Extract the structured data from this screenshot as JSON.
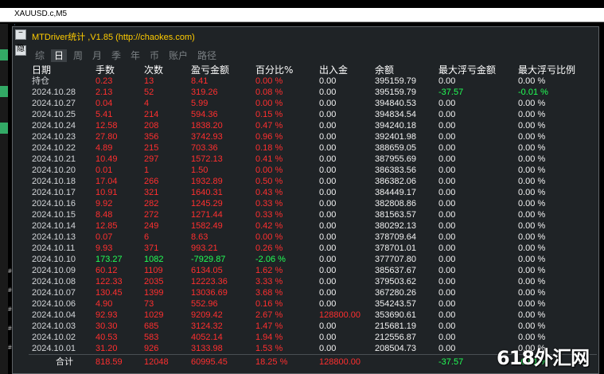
{
  "chart": {
    "symbol_tab": "XAUUSD.c,M5",
    "side_marks": [
      "#3",
      "#3",
      "#3",
      "#3",
      "#3"
    ]
  },
  "window": {
    "title": "MTDriver统计 ,V1.85 (http://chaokes.com)",
    "btn_top": "−",
    "btn_bottom": "隐"
  },
  "tabs": [
    {
      "label": "综",
      "active": false
    },
    {
      "label": "日",
      "active": true
    },
    {
      "label": "周",
      "active": false
    },
    {
      "label": "月",
      "active": false
    },
    {
      "label": "季",
      "active": false
    },
    {
      "label": "年",
      "active": false
    },
    {
      "label": "币",
      "active": false
    },
    {
      "label": "账户",
      "active": false
    },
    {
      "label": "路径",
      "active": false
    }
  ],
  "columns": [
    "日期",
    "手数",
    "次数",
    "盈亏金额",
    "百分比%",
    "出入金",
    "余额",
    "最大浮亏金额",
    "最大浮亏比例"
  ],
  "rows": [
    {
      "date": "持仓",
      "lots": "0.23",
      "count": "13",
      "pl": "8.41",
      "pct": "0.00 %",
      "flow": "0.00",
      "bal": "395159.79",
      "maxamt": "0.00",
      "maxpct": "0.00 %",
      "color": "red"
    },
    {
      "date": "2024.10.28",
      "lots": "2.13",
      "count": "52",
      "pl": "319.26",
      "pct": "0.08 %",
      "flow": "0.00",
      "bal": "395159.79",
      "maxamt": "-37.57",
      "maxpct": "-0.01 %",
      "color": "red",
      "maxcolor": "green"
    },
    {
      "date": "2024.10.27",
      "lots": "0.04",
      "count": "4",
      "pl": "5.99",
      "pct": "0.00 %",
      "flow": "0.00",
      "bal": "394840.53",
      "maxamt": "0.00",
      "maxpct": "0.00 %",
      "color": "red"
    },
    {
      "date": "2024.10.25",
      "lots": "5.41",
      "count": "214",
      "pl": "594.36",
      "pct": "0.15 %",
      "flow": "0.00",
      "bal": "394834.54",
      "maxamt": "0.00",
      "maxpct": "0.00 %",
      "color": "red"
    },
    {
      "date": "2024.10.24",
      "lots": "12.58",
      "count": "208",
      "pl": "1838.20",
      "pct": "0.47 %",
      "flow": "0.00",
      "bal": "394240.18",
      "maxamt": "0.00",
      "maxpct": "0.00 %",
      "color": "red"
    },
    {
      "date": "2024.10.23",
      "lots": "27.80",
      "count": "356",
      "pl": "3742.93",
      "pct": "0.96 %",
      "flow": "0.00",
      "bal": "392401.98",
      "maxamt": "0.00",
      "maxpct": "0.00 %",
      "color": "red"
    },
    {
      "date": "2024.10.22",
      "lots": "4.89",
      "count": "215",
      "pl": "703.36",
      "pct": "0.18 %",
      "flow": "0.00",
      "bal": "388659.05",
      "maxamt": "0.00",
      "maxpct": "0.00 %",
      "color": "red"
    },
    {
      "date": "2024.10.21",
      "lots": "10.49",
      "count": "297",
      "pl": "1572.13",
      "pct": "0.41 %",
      "flow": "0.00",
      "bal": "387955.69",
      "maxamt": "0.00",
      "maxpct": "0.00 %",
      "color": "red"
    },
    {
      "date": "2024.10.20",
      "lots": "0.01",
      "count": "1",
      "pl": "1.50",
      "pct": "0.00 %",
      "flow": "0.00",
      "bal": "386383.56",
      "maxamt": "0.00",
      "maxpct": "0.00 %",
      "color": "red"
    },
    {
      "date": "2024.10.18",
      "lots": "17.04",
      "count": "266",
      "pl": "1932.89",
      "pct": "0.50 %",
      "flow": "0.00",
      "bal": "386382.06",
      "maxamt": "0.00",
      "maxpct": "0.00 %",
      "color": "red"
    },
    {
      "date": "2024.10.17",
      "lots": "10.91",
      "count": "321",
      "pl": "1640.31",
      "pct": "0.43 %",
      "flow": "0.00",
      "bal": "384449.17",
      "maxamt": "0.00",
      "maxpct": "0.00 %",
      "color": "red"
    },
    {
      "date": "2024.10.16",
      "lots": "9.92",
      "count": "282",
      "pl": "1245.29",
      "pct": "0.33 %",
      "flow": "0.00",
      "bal": "382808.86",
      "maxamt": "0.00",
      "maxpct": "0.00 %",
      "color": "red"
    },
    {
      "date": "2024.10.15",
      "lots": "8.48",
      "count": "272",
      "pl": "1271.44",
      "pct": "0.33 %",
      "flow": "0.00",
      "bal": "381563.57",
      "maxamt": "0.00",
      "maxpct": "0.00 %",
      "color": "red"
    },
    {
      "date": "2024.10.14",
      "lots": "12.85",
      "count": "249",
      "pl": "1582.49",
      "pct": "0.42 %",
      "flow": "0.00",
      "bal": "380292.13",
      "maxamt": "0.00",
      "maxpct": "0.00 %",
      "color": "red"
    },
    {
      "date": "2024.10.13",
      "lots": "0.07",
      "count": "6",
      "pl": "8.63",
      "pct": "0.00 %",
      "flow": "0.00",
      "bal": "378709.64",
      "maxamt": "0.00",
      "maxpct": "0.00 %",
      "color": "red"
    },
    {
      "date": "2024.10.11",
      "lots": "9.93",
      "count": "371",
      "pl": "993.21",
      "pct": "0.26 %",
      "flow": "0.00",
      "bal": "378701.01",
      "maxamt": "0.00",
      "maxpct": "0.00 %",
      "color": "red"
    },
    {
      "date": "2024.10.10",
      "lots": "173.27",
      "count": "1082",
      "pl": "-7929.87",
      "pct": "-2.06 %",
      "flow": "0.00",
      "bal": "377707.80",
      "maxamt": "0.00",
      "maxpct": "0.00 %",
      "color": "green"
    },
    {
      "date": "2024.10.09",
      "lots": "60.12",
      "count": "1109",
      "pl": "6134.05",
      "pct": "1.62 %",
      "flow": "0.00",
      "bal": "385637.67",
      "maxamt": "0.00",
      "maxpct": "0.00 %",
      "color": "red"
    },
    {
      "date": "2024.10.08",
      "lots": "122.33",
      "count": "2035",
      "pl": "12223.36",
      "pct": "3.33 %",
      "flow": "0.00",
      "bal": "379503.62",
      "maxamt": "0.00",
      "maxpct": "0.00 %",
      "color": "red"
    },
    {
      "date": "2024.10.07",
      "lots": "130.45",
      "count": "1399",
      "pl": "13036.69",
      "pct": "3.68 %",
      "flow": "0.00",
      "bal": "367280.26",
      "maxamt": "0.00",
      "maxpct": "0.00 %",
      "color": "red"
    },
    {
      "date": "2024.10.06",
      "lots": "4.90",
      "count": "73",
      "pl": "552.96",
      "pct": "0.16 %",
      "flow": "0.00",
      "bal": "354243.57",
      "maxamt": "0.00",
      "maxpct": "0.00 %",
      "color": "red"
    },
    {
      "date": "2024.10.04",
      "lots": "92.93",
      "count": "1029",
      "pl": "9209.42",
      "pct": "2.67 %",
      "flow": "128800.00",
      "bal": "353690.61",
      "maxamt": "0.00",
      "maxpct": "0.00 %",
      "color": "red",
      "flowcolor": "red"
    },
    {
      "date": "2024.10.03",
      "lots": "30.30",
      "count": "685",
      "pl": "3124.32",
      "pct": "1.47 %",
      "flow": "0.00",
      "bal": "215681.19",
      "maxamt": "0.00",
      "maxpct": "0.00 %",
      "color": "red"
    },
    {
      "date": "2024.10.02",
      "lots": "40.53",
      "count": "583",
      "pl": "4052.14",
      "pct": "1.94 %",
      "flow": "0.00",
      "bal": "212556.87",
      "maxamt": "0.00",
      "maxpct": "0.00 %",
      "color": "red"
    },
    {
      "date": "2024.10.01",
      "lots": "31.20",
      "count": "926",
      "pl": "3133.98",
      "pct": "1.53 %",
      "flow": "0.00",
      "bal": "208504.73",
      "maxamt": "0.00",
      "maxpct": "0.00 %",
      "color": "red"
    }
  ],
  "total": {
    "label": "合计",
    "lots": "818.59",
    "count": "12048",
    "pl": "60995.45",
    "pct": "18.25 %",
    "flow": "128800.00",
    "maxamt": "-37.57",
    "maxpct": "-0.01 %"
  },
  "watermark": "618外汇网",
  "colors": {
    "window_bg": "#1f2326",
    "title": "#ffcc00",
    "profit": "#ff2f2f",
    "loss": "#22ff55",
    "neutral": "#f2f2f2"
  }
}
